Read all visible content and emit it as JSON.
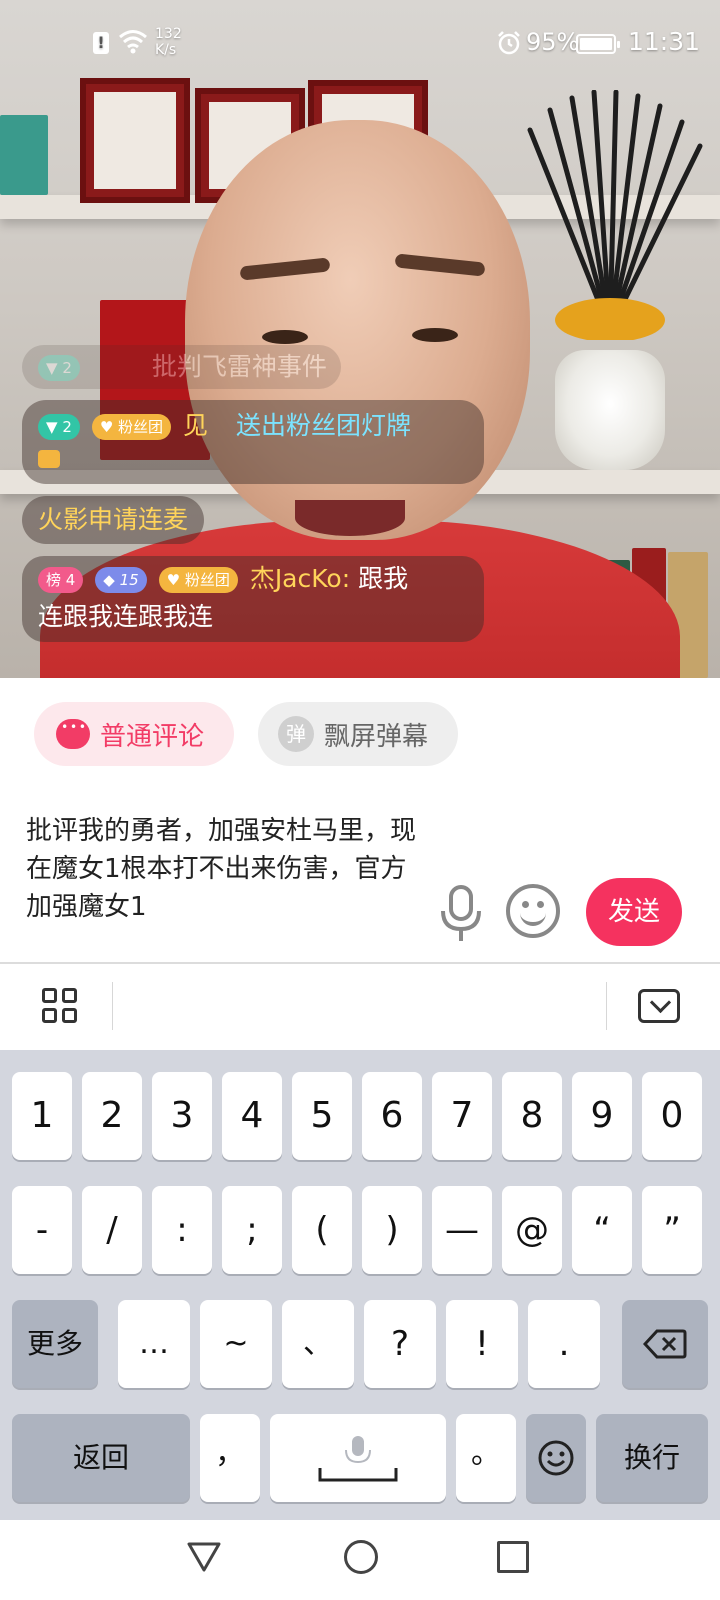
{
  "status_bar": {
    "net_speed_value": "132",
    "net_speed_unit": "K/s",
    "battery": "95%",
    "time": "11:31"
  },
  "chat": {
    "faded_message": {
      "level": "2",
      "text": "批判飞雷神事件"
    },
    "gift_message": {
      "level": "2",
      "fan_badge": "粉丝团",
      "user": "见",
      "text": "送出粉丝团灯牌"
    },
    "request_message": {
      "text": "火影申请连麦"
    },
    "user_message": {
      "rank_badge": "榜 4",
      "gem_level": "15",
      "fan_badge": "粉丝团",
      "user": "杰JacKo:",
      "text_line1": "跟我",
      "text_line2": "连跟我连跟我连"
    }
  },
  "comment_tabs": {
    "normal": "普通评论",
    "danmu_icon": "弹",
    "danmu": "飘屏弹幕"
  },
  "input": {
    "value": "批评我的勇者，加强安杜马里，现在魔女1根本打不出来伤害，官方加强魔女1",
    "send_label": "发送"
  },
  "keyboard": {
    "row1": [
      "1",
      "2",
      "3",
      "4",
      "5",
      "6",
      "7",
      "8",
      "9",
      "0"
    ],
    "row2": [
      "-",
      "/",
      ":",
      ";",
      "(",
      ")",
      "—",
      "@",
      "“",
      "”"
    ],
    "row3": [
      "更多",
      "…",
      "~",
      "、",
      "?",
      "!",
      "."
    ],
    "row4": {
      "back": "返回",
      "comma": "，",
      "period": "。",
      "newline": "换行"
    }
  },
  "colors": {
    "accent_pink": "#f5325f",
    "keyboard_bg": "#d3d6de"
  }
}
